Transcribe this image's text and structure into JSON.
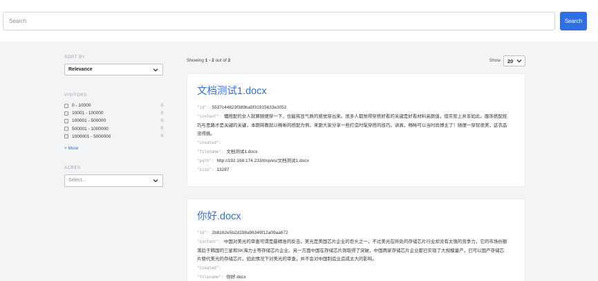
{
  "search": {
    "placeholder": "Search",
    "button_label": "Search"
  },
  "sidebar": {
    "sort": {
      "title": "SORT BY",
      "selected": "Relevance"
    },
    "visitors": {
      "title": "VISITORS",
      "items": [
        {
          "label": "0 - 10000",
          "count": "0"
        },
        {
          "label": "10001 - 100000",
          "count": "0"
        },
        {
          "label": "100001 - 500000",
          "count": "0"
        },
        {
          "label": "500001 - 1000000",
          "count": "0"
        },
        {
          "label": "1000001 - 5000000",
          "count": "0"
        }
      ],
      "more_label": "+ More"
    },
    "acres": {
      "title": "ACRES",
      "placeholder": "Select..."
    }
  },
  "results": {
    "showing_prefix": "Showing ",
    "range": "1 - 2",
    "out_of_text": " out of ",
    "total": "2",
    "show_label": "Show",
    "per_page": "20",
    "items": [
      {
        "title": "文档测试1.docx",
        "fields": [
          {
            "key": "\"id\":",
            "value": "5537c44823f389ba5f31915633e3052"
          },
          {
            "key": "\"content\":",
            "value": "懂搭配的女人就算随便穿一下，也能将显气质的感觉穿出来。很多人都觉得穿搭好看的关键是好看材料高颜值，但实际上并非如此。服饰搭配技巧与思路才是关键的关键，本期将教就以畅晰的搭配为例，来跟大家分享一些打造时髦穿搭的技巧。讲真，畅晰可以当时尚博主了！随便一穿就很美，这衣品没得挑。"
          },
          {
            "key": "\"created\":",
            "value": ""
          },
          {
            "key": "\"filename\":",
            "value": "文档测试1.docx"
          },
          {
            "key": "\"path\":",
            "value": "http://192.168.174.233/tmp/es/文档测试1.docx"
          },
          {
            "key": "\"size\":",
            "value": "13287"
          }
        ]
      },
      {
        "title": "你好.docx",
        "fields": [
          {
            "key": "\"id\":",
            "value": "2b8162e5b2d198a96349f12a09aa672"
          },
          {
            "key": "\"content\":",
            "value": "中国对美光的审查可谓是最精准的反击，美光是美国芯片企业的巨头之一，不过美光在所处的存储芯片行业却没有太强的竞争力，它的市场份额落后于韩国的三星和SK海力士等存储芯片企业。另一方面中国在存储芯片则取得了突破，中国两家存储芯片企业都已实现了大规模量产，已可以国产存储芯片替代美光的存储芯片，如此情况下对美光的审查，并不会对中国制造业造成太大的影响。"
          },
          {
            "key": "\"created\":",
            "value": ""
          },
          {
            "key": "\"filename\":",
            "value": "你好.docx"
          }
        ]
      }
    ]
  },
  "colors": {
    "accent": "#2f6fe4",
    "background": "#f3f4f6",
    "muted": "#9a9ea5"
  },
  "icons": {
    "dropdown": "chevron-down-icon",
    "checkbox": "checkbox-icon"
  }
}
